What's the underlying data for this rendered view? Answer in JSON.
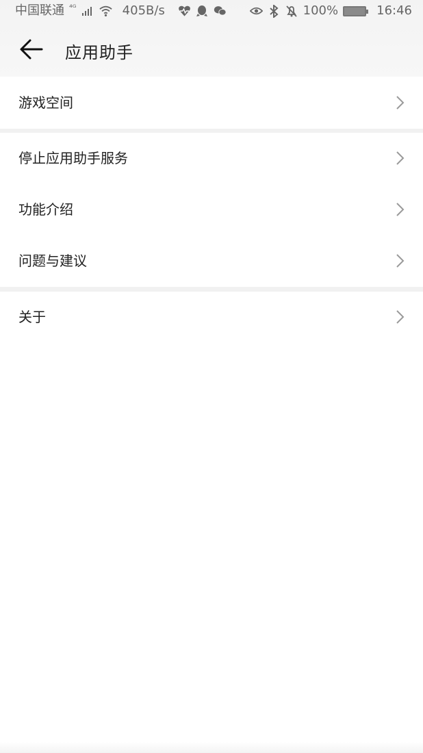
{
  "status_bar": {
    "carrier": "中国联通",
    "network": "⁴ᴳ",
    "speed": "405B/s",
    "battery": "100%",
    "time": "16:46",
    "icons": [
      "signal-icon",
      "wifi-icon",
      "heart-rate-icon",
      "qq-icon",
      "wechat-icon",
      "eye-icon",
      "bluetooth-icon",
      "mute-icon",
      "battery-icon"
    ]
  },
  "header": {
    "title": "应用助手",
    "back_icon": "arrow-left-icon"
  },
  "sections": [
    {
      "items": [
        {
          "label": "游戏空间"
        }
      ]
    },
    {
      "items": [
        {
          "label": "停止应用助手服务"
        },
        {
          "label": "功能介绍"
        },
        {
          "label": "问题与建议"
        }
      ]
    },
    {
      "items": [
        {
          "label": "关于"
        }
      ]
    }
  ],
  "colors": {
    "background": "#ffffff",
    "separator": "#f1f1f1",
    "text": "#222222",
    "secondary_text": "#666666",
    "chevron": "#9a9a9a"
  }
}
